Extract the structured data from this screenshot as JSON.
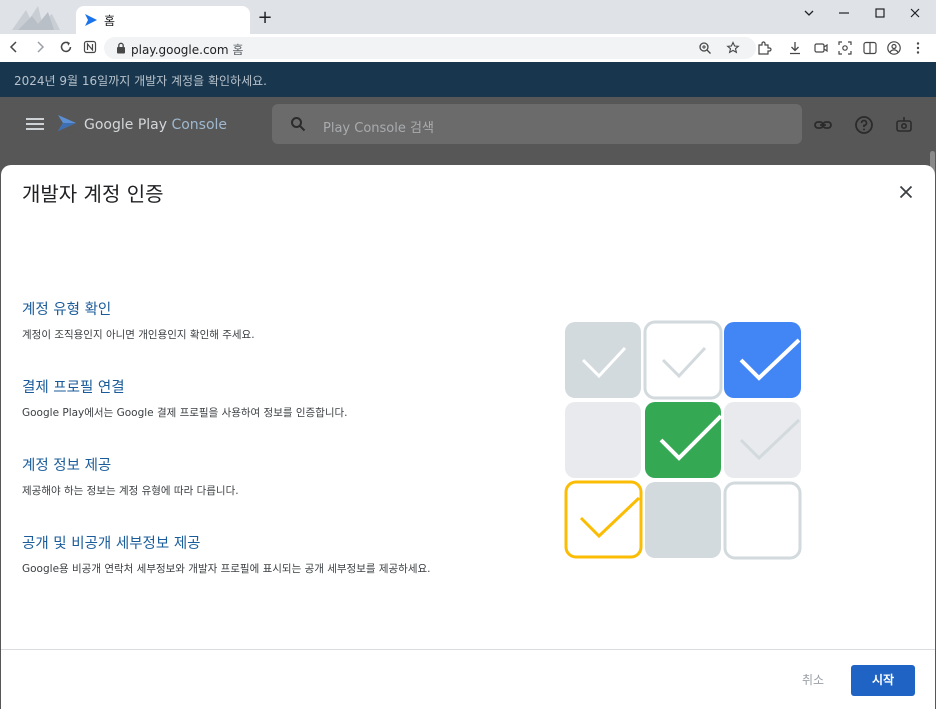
{
  "browser": {
    "tab_title": "홈",
    "new_tab_label": "+",
    "url_host": "play.google.com",
    "url_path": " 홈",
    "accent_color": "#dfe3e8"
  },
  "banner": {
    "text": "2024년 9월 16일까지 개발자 계정을 확인하세요."
  },
  "app": {
    "brand_prefix": "Google Play ",
    "brand_suffix": "Console",
    "search_placeholder": "Play Console 검색"
  },
  "dialog": {
    "title": "개발자 계정 인증",
    "steps": [
      {
        "title": "계정 유형 확인",
        "desc": "계정이 조직용인지 아니면 개인용인지 확인해 주세요."
      },
      {
        "title": "결제 프로필 연결",
        "desc": "Google Play에서는 Google 결제 프로필을 사용하여 정보를 인증합니다."
      },
      {
        "title": "계정 정보 제공",
        "desc": "제공해야 하는 정보는 계정 유형에 따라 다릅니다."
      },
      {
        "title": "공개 및 비공개 세부정보 제공",
        "desc": "Google용 비공개 연락처 세부정보와 개발자 프로필에 표시되는 공개 세부정보를 제공하세요."
      }
    ],
    "cancel_label": "취소",
    "start_label": "시작",
    "colors": {
      "blue": "#4285f4",
      "green": "#34a853",
      "yellow": "#fbbc04",
      "grey": "#d3dade",
      "light": "#e8eaed"
    }
  },
  "icons": [
    "back-icon",
    "forward-icon",
    "reload-icon",
    "lock-icon",
    "zoom-icon",
    "bookmark-icon",
    "extensions-icon",
    "download-icon",
    "cast-icon",
    "screenshot-icon",
    "sidepanel-icon",
    "profile-icon",
    "menu-icon",
    "search-icon",
    "link-icon",
    "help-icon",
    "notifications-icon",
    "close-icon"
  ]
}
